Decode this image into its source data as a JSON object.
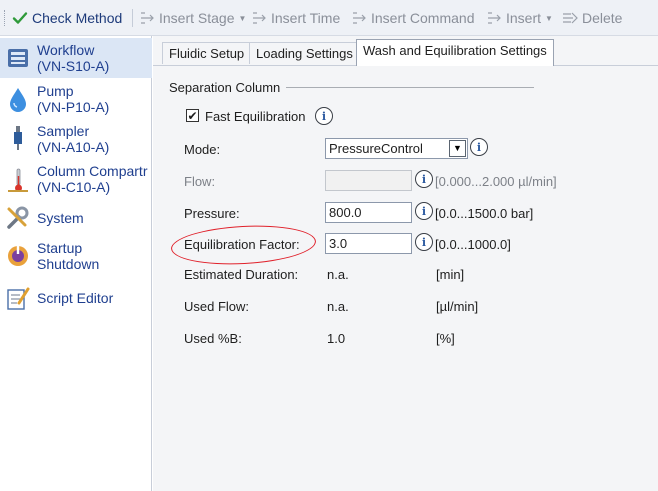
{
  "toolbar": {
    "items": [
      {
        "label": "Check Method",
        "icon": "checkmark-icon",
        "active": true
      },
      {
        "label": "Insert Stage",
        "icon": "insert-icon",
        "dropdown": true
      },
      {
        "label": "Insert Time",
        "icon": "insert-icon"
      },
      {
        "label": "Insert Command",
        "icon": "insert-icon"
      },
      {
        "label": "Insert",
        "icon": "insert-icon",
        "dropdown": true
      },
      {
        "label": "Delete",
        "icon": "delete-icon"
      }
    ]
  },
  "sidebar": {
    "items": [
      {
        "line1": "Workflow",
        "line2": "(VN-S10-A)",
        "icon": "workflow-icon",
        "selected": true
      },
      {
        "line1": "Pump",
        "line2": "(VN-P10-A)",
        "icon": "pump-drop-icon"
      },
      {
        "line1": "Sampler",
        "line2": "(VN-A10-A)",
        "icon": "sampler-icon"
      },
      {
        "line1": "Column Compartr",
        "line2": "(VN-C10-A)",
        "icon": "thermometer-icon"
      },
      {
        "line1": "System",
        "line2": "",
        "icon": "tools-icon"
      },
      {
        "line1": "Startup",
        "line2": "Shutdown",
        "icon": "power-icon"
      },
      {
        "line1": "Script Editor",
        "line2": "",
        "icon": "script-editor-icon"
      }
    ]
  },
  "tabs": [
    {
      "label": "Fluidic Setup"
    },
    {
      "label": "Loading Settings"
    },
    {
      "label": "Wash and Equilibration Settings",
      "active": true
    }
  ],
  "panel": {
    "group_title": "Separation Column",
    "fast_equilibration": {
      "label": "Fast Equilibration",
      "checked": true
    },
    "mode": {
      "label": "Mode:",
      "value": "PressureControl"
    },
    "flow": {
      "label": "Flow:",
      "value": "",
      "range": "[0.000...2.000 µl/min]"
    },
    "pressure": {
      "label": "Pressure:",
      "value": "800.0",
      "range": "[0.0...1500.0 bar]"
    },
    "equilibration_factor": {
      "label": "Equilibration Factor:",
      "value": "3.0",
      "range": "[0.0...1000.0]"
    },
    "estimated_duration": {
      "label": "Estimated Duration:",
      "value": "n.a.",
      "unit": "[min]"
    },
    "used_flow": {
      "label": "Used Flow:",
      "value": "n.a.",
      "unit": "[µl/min]"
    },
    "used_percent_b": {
      "label": "Used %B:",
      "value": "1.0",
      "unit": "[%]"
    }
  },
  "colors": {
    "annotation": "#e0202a",
    "link_text": "#1f3f8f",
    "selected_bg": "#dbe6f5"
  }
}
